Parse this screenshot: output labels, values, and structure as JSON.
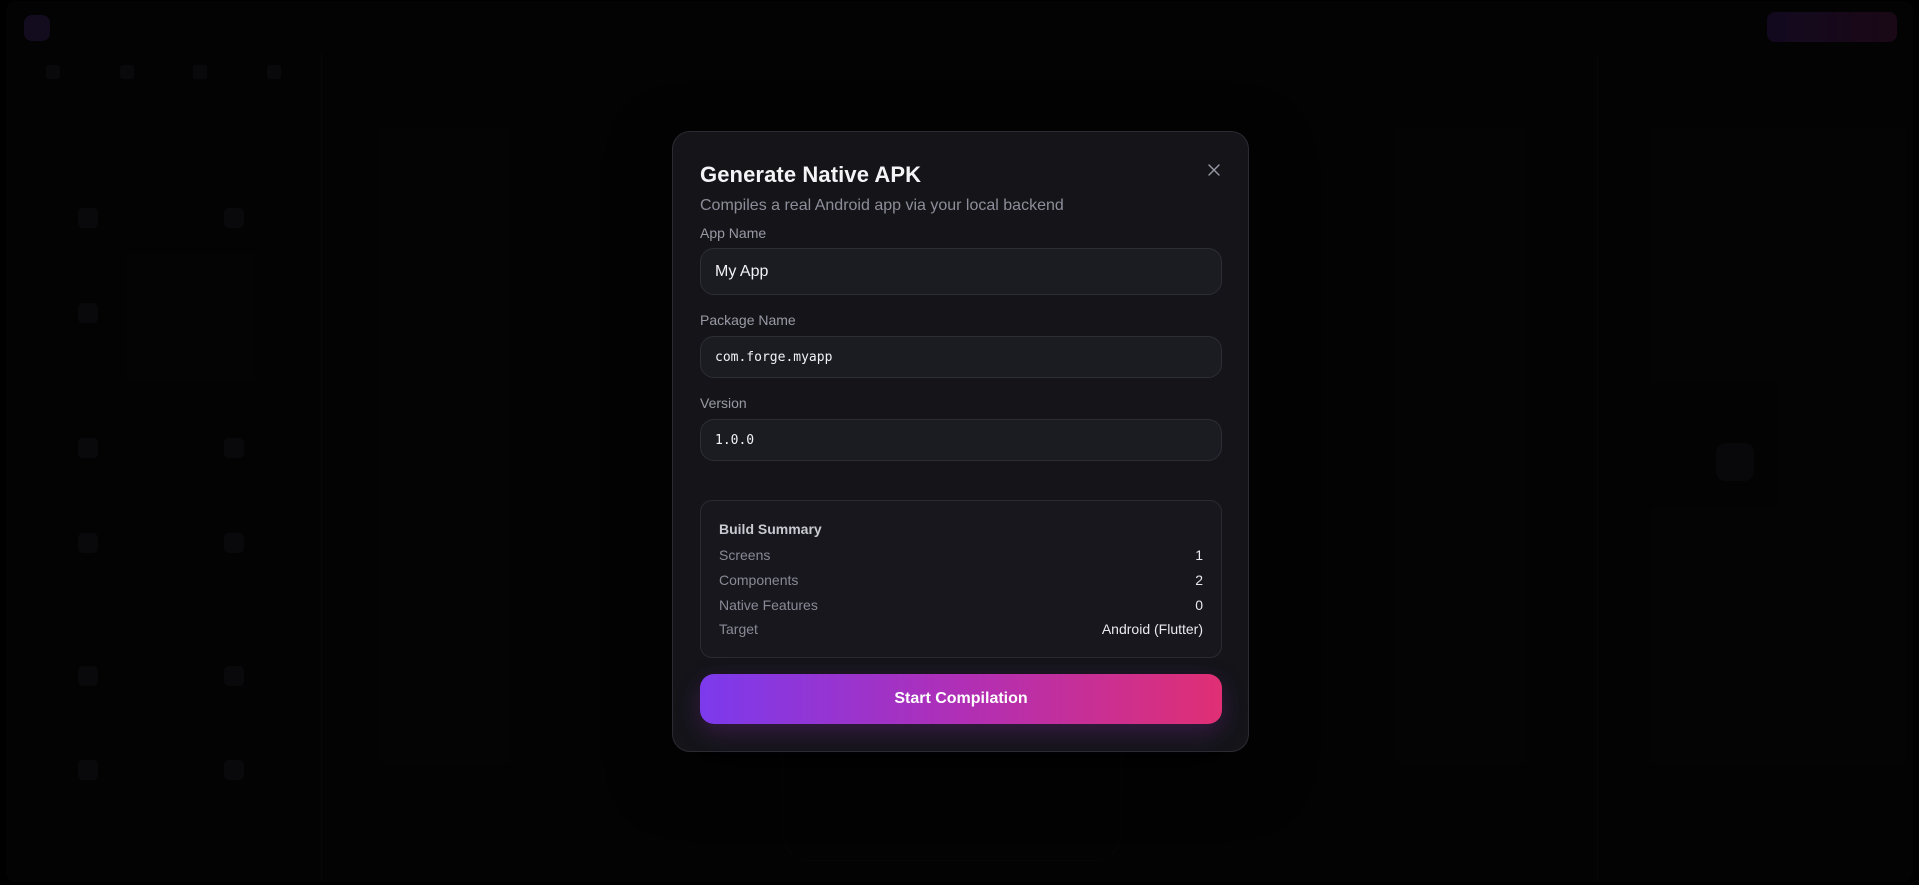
{
  "modal": {
    "title": "Generate Native APK",
    "subtitle": "Compiles a real Android app via your local backend",
    "close_icon": "close-icon",
    "fields": {
      "app_name_label": "App Name",
      "app_name_value": "My App",
      "package_label": "Package Name",
      "package_value": "com.forge.myapp",
      "version_label": "Version",
      "version_value": "1.0.0"
    },
    "summary": {
      "title": "Build Summary",
      "rows": [
        {
          "key": "Screens",
          "value": "1"
        },
        {
          "key": "Components",
          "value": "2"
        },
        {
          "key": "Native Features",
          "value": "0"
        },
        {
          "key": "Target",
          "value": "Android (Flutter)"
        }
      ]
    },
    "compile_label": "Start Compilation"
  },
  "colors": {
    "accent_start": "#7c3aed",
    "accent_end": "#e02f74",
    "modal_bg": "#141419"
  }
}
